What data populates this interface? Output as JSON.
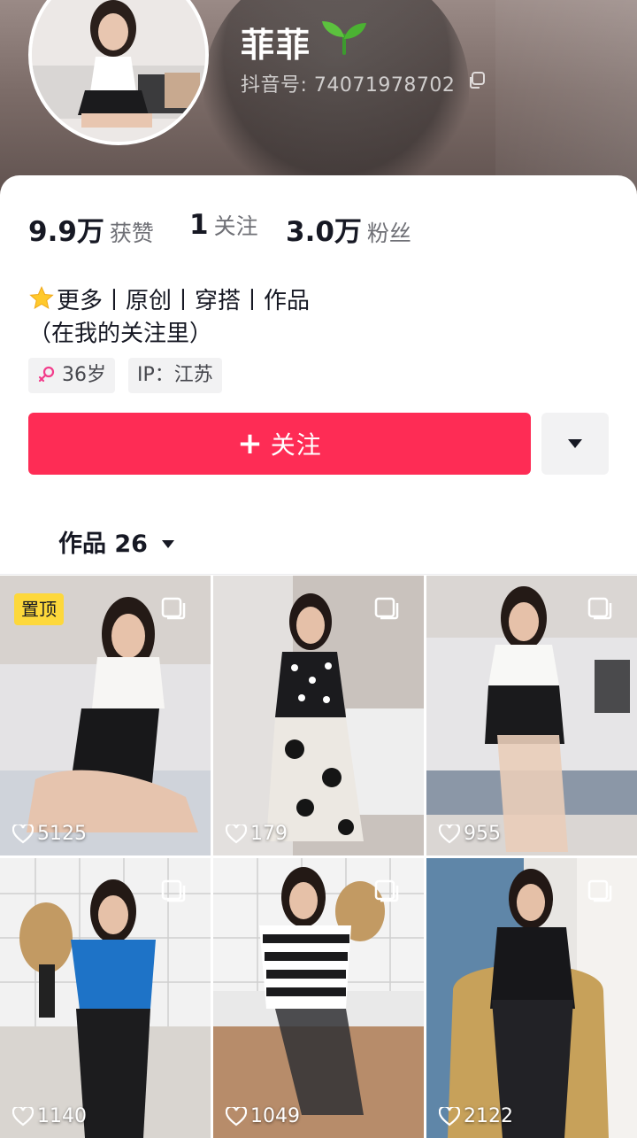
{
  "profile": {
    "nickname": "菲菲",
    "account_id": "抖音号: 74071978702",
    "stats": [
      {
        "value": "9.9万",
        "label": "获赞"
      },
      {
        "value": "1",
        "label": "关注"
      },
      {
        "value": "3.0万",
        "label": "粉丝"
      }
    ],
    "bio_line1": "更多丨原创丨穿搭丨作品",
    "bio_line2": "（在我的关注里）",
    "tags": [
      {
        "text": "36岁",
        "icon": "female-icon"
      },
      {
        "text": "IP：江苏"
      }
    ]
  },
  "actions": {
    "follow_label": "关注",
    "follow_color": "#fe2c55"
  },
  "works_tab": {
    "label": "作品 26"
  },
  "videos": [
    {
      "likes": "5125",
      "pinned_label": "置顶",
      "scene": "white-top-sofa"
    },
    {
      "likes": "179",
      "scene": "polka-dot-dress"
    },
    {
      "likes": "955",
      "scene": "white-top-sofa-2"
    },
    {
      "likes": "1140",
      "scene": "blue-top-kitchen"
    },
    {
      "likes": "1049",
      "scene": "striped-top-kitchen"
    },
    {
      "likes": "2122",
      "scene": "black-dress-chair"
    }
  ]
}
